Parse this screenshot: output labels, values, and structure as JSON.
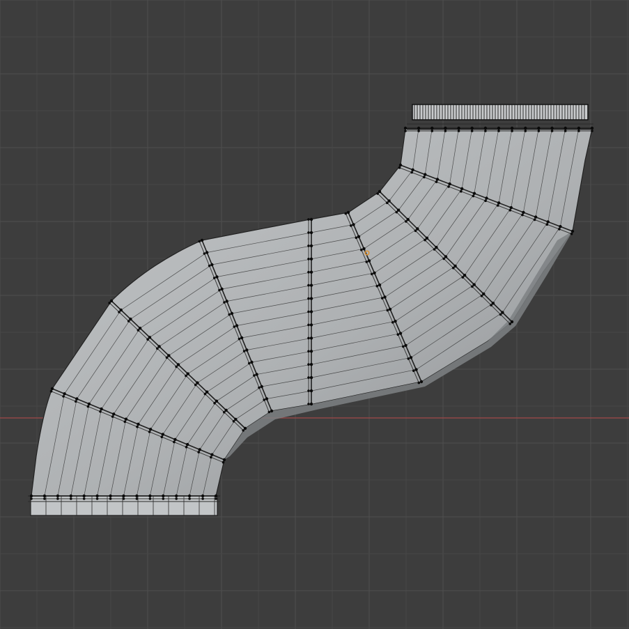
{
  "viewport": {
    "background_color": "#3d3d3d",
    "grid_minor_color": "#474747",
    "grid_major_color": "#4e4e4e",
    "x_axis_color": "#a24848",
    "mesh_fill_light": "#b9bcbe",
    "mesh_fill_dark": "#8e9194",
    "edge_color": "#2a2a2a",
    "vertex_color": "#0a0a0a",
    "active_vertex_color": "#e0902a",
    "object": "pipe-mesh",
    "mode": "edit-mode",
    "view": "orthographic"
  }
}
